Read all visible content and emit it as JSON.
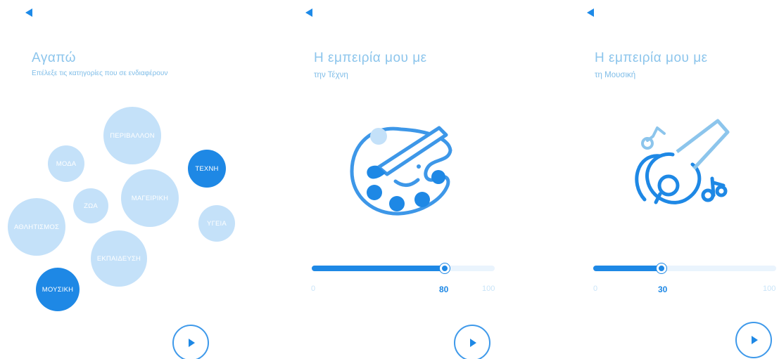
{
  "colors": {
    "accent": "#1e88e5",
    "bubble": "#c4e1f9",
    "text": "#8cc5ec"
  },
  "screen1": {
    "back_icon": "back-arrow-icon",
    "title": "Αγαπώ",
    "subtitle": "Επέλεξε τις κατηγορίες που σε ενδιαφέρουν",
    "categories": [
      {
        "label": "ΠΕΡΙΒΑΛΛΟΝ",
        "selected": false
      },
      {
        "label": "ΜΟΔΑ",
        "selected": false
      },
      {
        "label": "ΤΕΧΝΗ",
        "selected": true
      },
      {
        "label": "ΖΩΑ",
        "selected": false
      },
      {
        "label": "ΜΑΓΕΙΡΙΚΗ",
        "selected": false
      },
      {
        "label": "ΑΘΛΗΤΙΣΜΟΣ",
        "selected": false
      },
      {
        "label": "ΥΓΕΙΑ",
        "selected": false
      },
      {
        "label": "ΕΚΠΑΙΔΕΥΣΗ",
        "selected": false
      },
      {
        "label": "ΜΟΥΣΙΚΗ",
        "selected": true
      }
    ],
    "play_icon": "play-icon"
  },
  "screen2": {
    "back_icon": "back-arrow-icon",
    "title": "Η εμπειρία μου με",
    "subtitle": "την Τέχνη",
    "illustration": "palette-icon",
    "slider": {
      "min": "0",
      "max": "100",
      "value": "80",
      "fraction": 0.8
    },
    "play_icon": "play-icon"
  },
  "screen3": {
    "back_icon": "back-arrow-icon",
    "title": "Η εμπειρία μου με",
    "subtitle": "τη Μουσική",
    "illustration": "guitar-icon",
    "slider": {
      "min": "0",
      "max": "100",
      "value": "30",
      "fraction": 0.3
    },
    "play_icon": "play-icon"
  }
}
